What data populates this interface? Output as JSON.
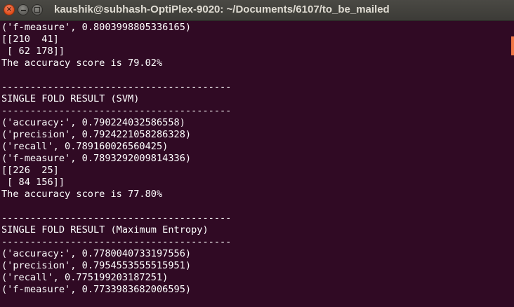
{
  "window": {
    "title": "kaushik@subhash-OptiPlex-9020: ~/Documents/6107/to_be_mailed",
    "close_glyph": "×",
    "close_color": "#df4a16",
    "titlebar_color": "#3c3b37",
    "background_color": "#300a24"
  },
  "terminal": {
    "lines": [
      "('f-measure', 0.8003998805336165)",
      "[[210  41]",
      " [ 62 178]]",
      "The accuracy score is 79.02%",
      "",
      "----------------------------------------",
      "SINGLE FOLD RESULT (SVM)",
      "----------------------------------------",
      "('accuracy:', 0.790224032586558)",
      "('precision', 0.7924221058286328)",
      "('recall', 0.789160026560425)",
      "('f-measure', 0.7893292009814336)",
      "[[226  25]",
      " [ 84 156]]",
      "The accuracy score is 77.80%",
      "",
      "----------------------------------------",
      "SINGLE FOLD RESULT (Maximum Entropy)",
      "----------------------------------------",
      "('accuracy:', 0.7780040733197556)",
      "('precision', 0.7954553555515951)",
      "('recall', 0.775199203187251)",
      "('f-measure', 0.7733983682006595)"
    ]
  }
}
